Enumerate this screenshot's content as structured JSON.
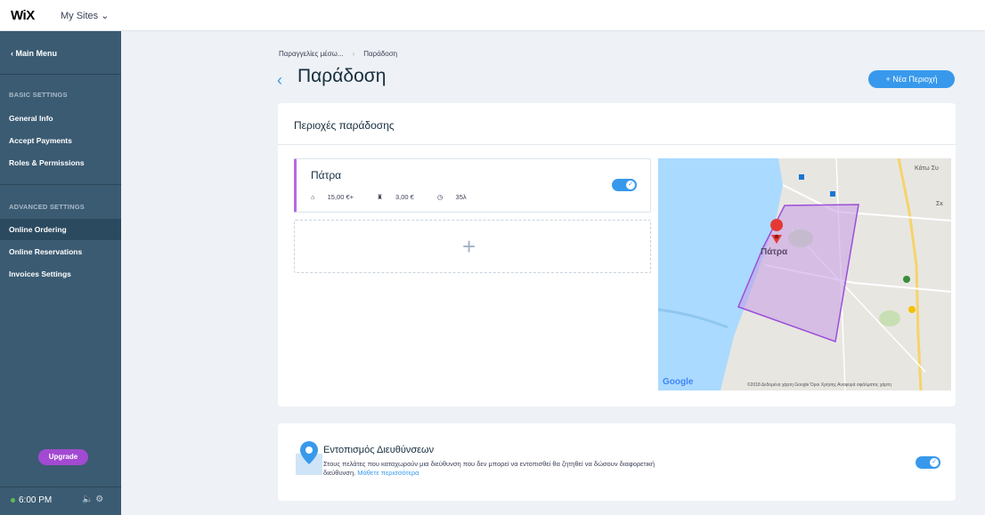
{
  "topbar": {
    "logo": "WiX",
    "my_sites": "My Sites ⌄"
  },
  "sidebar": {
    "back_label": "‹  Main Menu",
    "basic_heading": "BASIC SETTINGS",
    "basic_items": [
      "General Info",
      "Accept Payments",
      "Roles & Permissions"
    ],
    "advanced_heading": "ADVANCED SETTINGS",
    "advanced_items": [
      "Online Ordering",
      "Online Reservations",
      "Invoices Settings"
    ],
    "active_item": "Online Ordering",
    "upgrade_label": "Upgrade",
    "time": "6:00 PM",
    "status_icons": "🔈 ⚙"
  },
  "breadcrumb": {
    "parent": "Παραγγελίες μέσω...",
    "separator": "›",
    "current": "Παράδοση"
  },
  "header": {
    "back_icon": "‹",
    "title": "Παράδοση",
    "new_area_button": "+  Νέα Περιοχή"
  },
  "delivery_panel": {
    "title": "Περιοχές παράδοσης",
    "areas": [
      {
        "name": "Πάτρα",
        "min_order": "15,00 €+",
        "delivery_fee": "3,00 €",
        "time": "35λ",
        "enabled": true
      }
    ],
    "add_area_icon": "+"
  },
  "map": {
    "city_label": "Πάτρα",
    "label_kato": "Κάτω Συ",
    "label_sk": "Σκ",
    "google_logo": "Google",
    "attribution": "©2018 Δεδομένα χάρτη Google   Όροι Χρήσης   Αναφορά σφάλματος χάρτη",
    "area_fill": "#c59be6",
    "water_color": "#aadaff"
  },
  "location_panel": {
    "title": "Εντοπισμός Διευθύνσεων",
    "description": "Στους πελάτες που καταχωρούν μια διεύθυνση που δεν μπορεί να εντοπισθεί θα ζητηθεί να δώσουν διαφορετική διεύθυνση.",
    "learn_more": "Μάθετε περισσότερα",
    "enabled": true
  },
  "colors": {
    "accent": "#3899ec",
    "sidebar": "#3b5b72",
    "upgrade": "#a24ad2",
    "area_marker": "#b36be0"
  }
}
